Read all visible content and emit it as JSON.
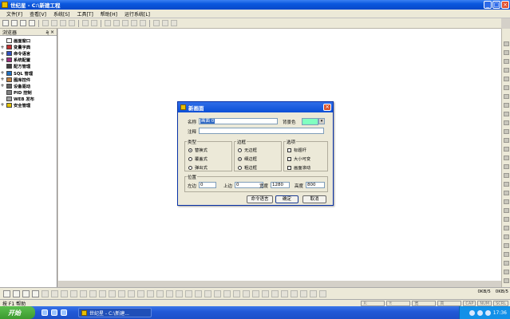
{
  "window": {
    "title": "世纪星 - C:\\新建工程"
  },
  "menu": [
    "文件[F]",
    "查看[V]",
    "系统[S]",
    "工具[T]",
    "帮助[H]",
    "运行系统[L]"
  ],
  "browser": {
    "title": "浏览器",
    "pin": "ą ×",
    "items": [
      {
        "label": "画面窗口",
        "expand": "",
        "color": "#ffffff"
      },
      {
        "label": "变量字典",
        "expand": "+",
        "color": "#c03030"
      },
      {
        "label": "命令语言",
        "expand": "+",
        "color": "#3050c0"
      },
      {
        "label": "系统配置",
        "expand": "+",
        "color": "#a03080"
      },
      {
        "label": "配方管理",
        "expand": "",
        "color": "#404040"
      },
      {
        "label": "SQL 管理",
        "expand": "+",
        "color": "#2070c0"
      },
      {
        "label": "图库控件",
        "expand": "+",
        "color": "#c08040"
      },
      {
        "label": "设备驱动",
        "expand": "+",
        "color": "#606060"
      },
      {
        "label": "PID 控制",
        "expand": "",
        "color": "#808080"
      },
      {
        "label": "WEB 发布",
        "expand": "",
        "color": "#a0a0a0"
      },
      {
        "label": "安全管理",
        "expand": "+",
        "color": "#e0c000"
      }
    ]
  },
  "dialog": {
    "title": "新画面",
    "close": "×",
    "name_label": "名称",
    "name_value": "画面 0",
    "bgcolor_label": "背景色",
    "bgcolor": "#80ffc0",
    "note_label": "注释",
    "note_value": "",
    "type_group": "类型",
    "type_options": [
      "替换式",
      "覆盖式",
      "弹出式"
    ],
    "border_group": "边框",
    "border_options": [
      "无边框",
      "细边框",
      "粗边框"
    ],
    "option_group": "选项",
    "option_items": [
      "标题杆",
      "大小可变",
      "画面滚动"
    ],
    "position_group": "位置",
    "left_label": "左边",
    "left_value": "0",
    "top_label": "上边",
    "top_value": "0",
    "width_label": "宽度",
    "width_value": "1280",
    "height_label": "高度",
    "height_value": "800",
    "cmd_button": "命令语言",
    "ok_button": "确定",
    "cancel_button": "取消"
  },
  "bottom": {
    "status1": "0KB/5",
    "status2": "0KB/5"
  },
  "statusbar": {
    "help": "按 F1 帮助",
    "cells": [
      "X:",
      "Y:",
      "宽",
      "高",
      "CAP",
      "NUM",
      "SCRL"
    ]
  },
  "taskbar": {
    "start": "开始",
    "task": "世纪星 - C:\\新建...",
    "clock": "17:36"
  }
}
